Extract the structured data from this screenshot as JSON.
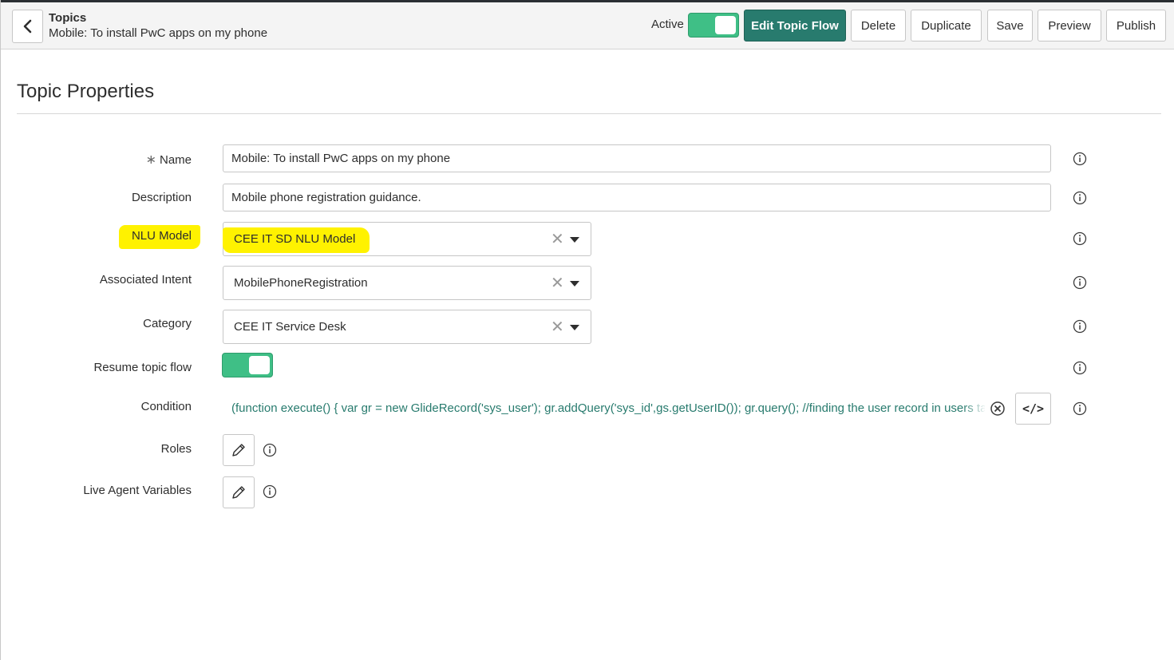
{
  "header": {
    "title": "Topics",
    "subtitle": "Mobile: To install PwC apps on my phone",
    "active_label": "Active",
    "active_on": true,
    "buttons": {
      "edit_flow": "Edit Topic Flow",
      "delete": "Delete",
      "duplicate": "Duplicate",
      "save": "Save",
      "preview": "Preview",
      "publish": "Publish"
    }
  },
  "section": {
    "title": "Topic Properties"
  },
  "form": {
    "name": {
      "label": "Name",
      "required_mark": "∗",
      "value": "Mobile: To install PwC apps on my phone"
    },
    "description": {
      "label": "Description",
      "value": "Mobile phone registration guidance."
    },
    "nlu_model": {
      "label": "NLU Model",
      "value": "CEE IT SD NLU Model"
    },
    "intent": {
      "label": "Associated Intent",
      "value": "MobilePhoneRegistration"
    },
    "category": {
      "label": "Category",
      "value": "CEE IT Service Desk"
    },
    "resume_flow": {
      "label": "Resume topic flow",
      "on": true
    },
    "condition": {
      "label": "Condition",
      "value": "(function execute() { var gr = new GlideRecord('sys_user'); gr.addQuery('sys_id',gs.getUserID()); gr.query(); //finding the user record in users table",
      "code_glyph": "</>"
    },
    "roles": {
      "label": "Roles"
    },
    "live_agent": {
      "label": "Live Agent Variables"
    }
  },
  "colors": {
    "accent": "#287b6e",
    "toggle_on": "#3fbf86",
    "highlight": "#fff200",
    "condition_text": "#287b6e"
  },
  "icons": {
    "back": "chevron-left-icon",
    "info": "info-icon",
    "clear": "close-icon",
    "caret": "caret-down-icon",
    "circle_clear": "circle-x-icon",
    "code": "code-icon",
    "edit": "pencil-icon"
  }
}
